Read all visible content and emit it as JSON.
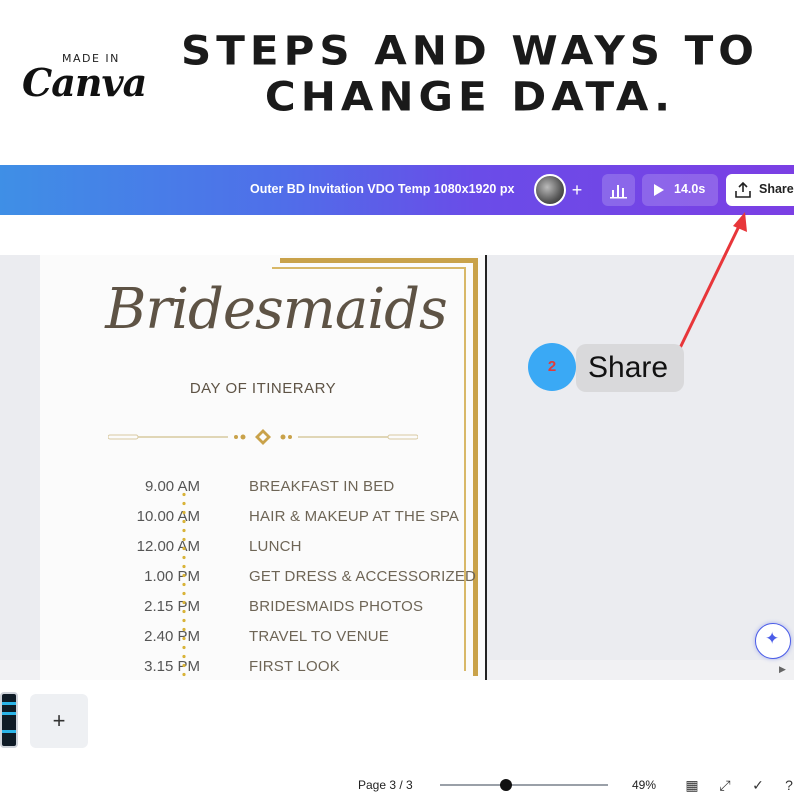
{
  "banner": {
    "made_in": "MADE IN",
    "brand": "Canva",
    "headline_line1": "STEPS AND WAYS TO",
    "headline_line2": "CHANGE DATA."
  },
  "toolbar": {
    "doc_title": "Outer BD Invitation VDO Temp  1080x1920 px",
    "add_label": "+",
    "play_duration": "14.0s",
    "share_label": "Share"
  },
  "design": {
    "title": "Bridesmaids",
    "subtitle": "DAY OF ITINERARY",
    "itinerary": [
      {
        "time": "9.00 AM",
        "event": "BREAKFAST IN BED"
      },
      {
        "time": "10.00 AM",
        "event": "HAIR & MAKEUP AT THE SPA"
      },
      {
        "time": "12.00 AM",
        "event": "LUNCH"
      },
      {
        "time": "1.00 PM",
        "event": "GET DRESS & ACCESSORIZED"
      },
      {
        "time": "2.15 PM",
        "event": "BRIDESMAIDS PHOTOS"
      },
      {
        "time": "2.40 PM",
        "event": "TRAVEL TO VENUE"
      },
      {
        "time": "3.15 PM",
        "event": "FIRST LOOK"
      }
    ],
    "accent_gold": "#c9a24a",
    "text_color": "#5e5345"
  },
  "annotation": {
    "step_number": "2",
    "label": "Share"
  },
  "pages": {
    "add_page_label": "+"
  },
  "footer": {
    "page_indicator": "Page 3 / 3",
    "zoom_percent": "49%",
    "zoom_level": 0.49
  },
  "colors": {
    "toolbar_start": "#3f8fe6",
    "toolbar_end": "#7b3fe4",
    "step_circle": "#3aa9f5",
    "arrow": "#e8363a"
  }
}
